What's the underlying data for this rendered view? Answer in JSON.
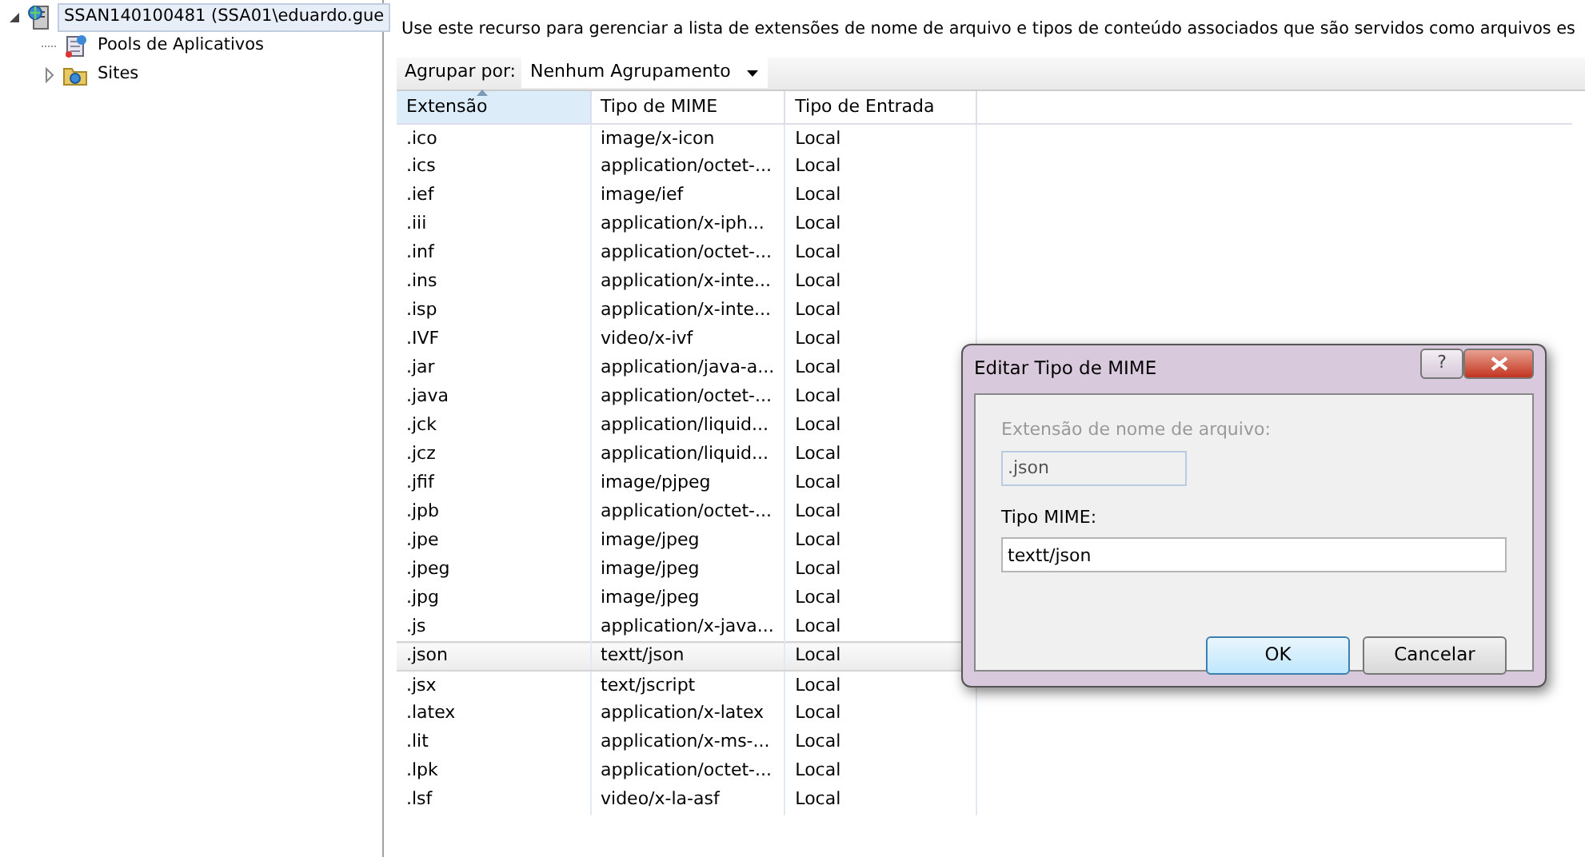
{
  "tree": [
    {
      "label": "SSAN140100481 (SSA01\\eduardo.gue",
      "kind": "server",
      "selected": true,
      "expanded": true,
      "children": [
        {
          "label": "Pools de Aplicativos",
          "kind": "pool",
          "selected": false
        },
        {
          "label": "Sites",
          "kind": "folder",
          "selected": false,
          "expanded": false
        }
      ]
    }
  ],
  "description": "Use este recurso para gerenciar a lista de extensões de nome de arquivo e tipos de conteúdo associados que são servidos como arquivos es",
  "group_by": {
    "label": "Agrupar por:",
    "value": "Nenhum Agrupamento"
  },
  "table": {
    "columns": [
      {
        "label": "Extensão",
        "sorted": true
      },
      {
        "label": "Tipo de MIME",
        "sorted": false
      },
      {
        "label": "Tipo de Entrada",
        "sorted": false
      }
    ],
    "rows": [
      {
        "cells": [
          ".ico",
          "image/x-icon",
          "Local"
        ],
        "selected": false
      },
      {
        "cells": [
          ".ics",
          "application/octet-...",
          "Local"
        ],
        "selected": false
      },
      {
        "cells": [
          ".ief",
          "image/ief",
          "Local"
        ],
        "selected": false
      },
      {
        "cells": [
          ".iii",
          "application/x-iph...",
          "Local"
        ],
        "selected": false
      },
      {
        "cells": [
          ".inf",
          "application/octet-...",
          "Local"
        ],
        "selected": false
      },
      {
        "cells": [
          ".ins",
          "application/x-inte...",
          "Local"
        ],
        "selected": false
      },
      {
        "cells": [
          ".isp",
          "application/x-inte...",
          "Local"
        ],
        "selected": false
      },
      {
        "cells": [
          ".IVF",
          "video/x-ivf",
          "Local"
        ],
        "selected": false
      },
      {
        "cells": [
          ".jar",
          "application/java-a...",
          "Local"
        ],
        "selected": false
      },
      {
        "cells": [
          ".java",
          "application/octet-...",
          "Local"
        ],
        "selected": false
      },
      {
        "cells": [
          ".jck",
          "application/liquid...",
          "Local"
        ],
        "selected": false
      },
      {
        "cells": [
          ".jcz",
          "application/liquid...",
          "Local"
        ],
        "selected": false
      },
      {
        "cells": [
          ".jfif",
          "image/pjpeg",
          "Local"
        ],
        "selected": false
      },
      {
        "cells": [
          ".jpb",
          "application/octet-...",
          "Local"
        ],
        "selected": false
      },
      {
        "cells": [
          ".jpe",
          "image/jpeg",
          "Local"
        ],
        "selected": false
      },
      {
        "cells": [
          ".jpeg",
          "image/jpeg",
          "Local"
        ],
        "selected": false
      },
      {
        "cells": [
          ".jpg",
          "image/jpeg",
          "Local"
        ],
        "selected": false
      },
      {
        "cells": [
          ".js",
          "application/x-java...",
          "Local"
        ],
        "selected": false
      },
      {
        "cells": [
          ".json",
          "textt/json",
          "Local"
        ],
        "selected": true
      },
      {
        "cells": [
          ".jsx",
          "text/jscript",
          "Local"
        ],
        "selected": false
      },
      {
        "cells": [
          ".latex",
          "application/x-latex",
          "Local"
        ],
        "selected": false
      },
      {
        "cells": [
          ".lit",
          "application/x-ms-...",
          "Local"
        ],
        "selected": false
      },
      {
        "cells": [
          ".lpk",
          "application/octet-...",
          "Local"
        ],
        "selected": false
      },
      {
        "cells": [
          ".lsf",
          "video/x-la-asf",
          "Local"
        ],
        "selected": false
      }
    ]
  },
  "dialog": {
    "title": "Editar Tipo de MIME",
    "help": "?",
    "fields": [
      {
        "label": "Extensão de nome de arquivo:",
        "value": ".json",
        "disabled": true
      },
      {
        "label": "Tipo MIME:",
        "value": "textt/json",
        "disabled": false
      }
    ],
    "buttons": [
      {
        "label": "OK",
        "default": true
      },
      {
        "label": "Cancelar",
        "default": false
      }
    ]
  }
}
